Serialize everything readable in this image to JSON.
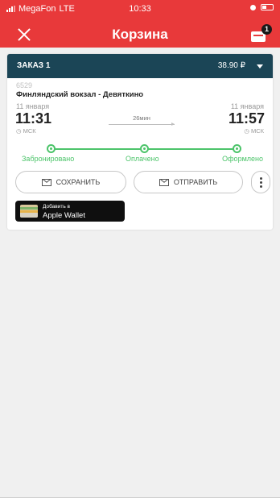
{
  "status_bar": {
    "carrier": "MegaFon",
    "network": "LTE",
    "time": "10:33"
  },
  "header": {
    "title": "Корзина",
    "cart_badge": "1",
    "color": "#e8393a"
  },
  "order": {
    "label": "ЗАКАЗ 1",
    "total": "38.90 ₽",
    "train_number": "6529",
    "route": "Финляндский вокзал - Девяткино",
    "departure": {
      "date": "11 января",
      "time": "11:31",
      "timezone": "МСК"
    },
    "arrival": {
      "date": "11 января",
      "time": "11:57",
      "timezone": "МСК"
    },
    "duration": "26мин",
    "steps": [
      "Забронировано",
      "Оплачено",
      "Оформлено"
    ],
    "save_label": "СОХРАНИТЬ",
    "send_label": "ОТПРАВИТЬ",
    "wallet": {
      "line1": "Добавить в",
      "line2": "Apple Wallet"
    }
  },
  "colors": {
    "order_header": "#1b4556",
    "progress": "#4cc46a",
    "background": "#f0f0f0"
  }
}
